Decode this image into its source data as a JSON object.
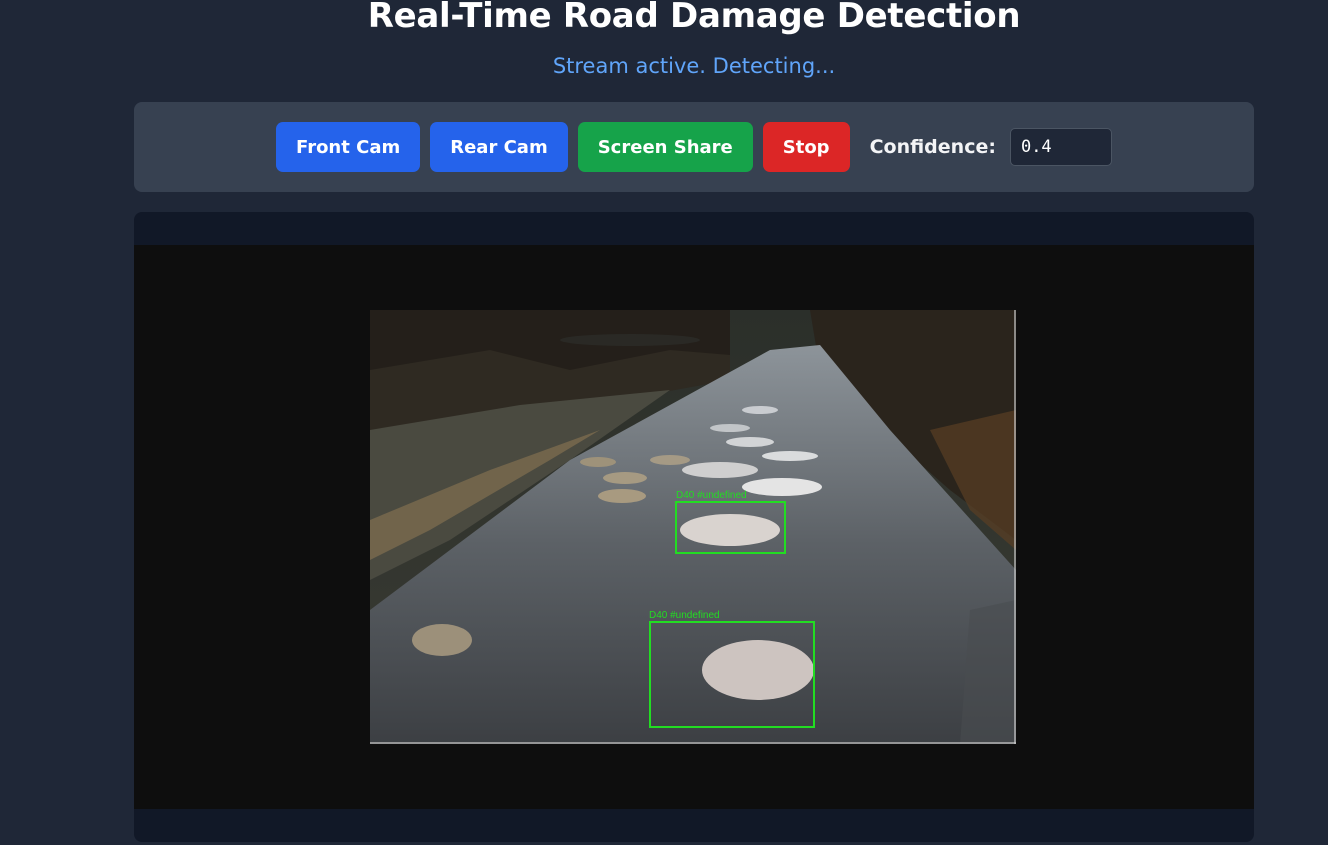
{
  "header": {
    "title": "Real-Time Road Damage Detection",
    "status": "Stream active. Detecting..."
  },
  "controls": {
    "front_cam": "Front Cam",
    "rear_cam": "Rear Cam",
    "screen_share": "Screen Share",
    "stop": "Stop",
    "confidence_label": "Confidence:",
    "confidence_value": "0.4"
  },
  "video": {
    "detections": [
      {
        "label": "D40 #undefined"
      },
      {
        "label": "D40 #undefined"
      }
    ]
  },
  "colors": {
    "background": "#1f2737",
    "panel": "#374151",
    "accent_blue": "#2563eb",
    "accent_green": "#16a34a",
    "accent_red": "#dc2626",
    "status_text": "#60a5fa",
    "detection_box": "#22dd22"
  }
}
